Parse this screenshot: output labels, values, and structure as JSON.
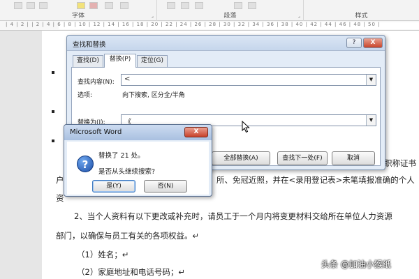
{
  "ribbon": {
    "groups": [
      "字体",
      "段落",
      "样式"
    ]
  },
  "ruler": {
    "text": "| 4 | 2 | | 2 | 4 | 6 | 8 | 10 | 12 | 14 | 16 | 18 | 20 | 22 | 24 | 26 | 28 | 30 | 32 | 34 | 36 | 38 | 40 | 42 | 44 | 46 | 48 | 50 |"
  },
  "document": {
    "line_r1": "职称证书",
    "line_a_prefix": "户",
    "line_a_suffix": "所、免冠近照，并在<录用登记表>未笔填报准确的个人",
    "line_b": "资",
    "para2_line1": "2、当个人资料有以下更改或补充时，请员工于一个月内将变更材料交给所在单位人力资源",
    "para2_line2": "部门，以确保与员工有关的各项权益。↵",
    "item1": "（1）姓名；↵",
    "item2": "（2）家庭地址和电话号码；↵"
  },
  "find_replace": {
    "title": "查找和替换",
    "help": "?",
    "close": "X",
    "tabs": [
      "查找(D)",
      "替换(P)",
      "定位(G)"
    ],
    "find_label": "查找内容(N):",
    "find_value": "<",
    "options_label": "选项:",
    "options_value": "向下搜索, 区分全/半角",
    "replace_label": "替换为(I):",
    "replace_value": "《",
    "buttons": {
      "replace_all": "全部替换(A)",
      "find_next": "查找下一处(F)",
      "cancel": "取消"
    }
  },
  "message_box": {
    "title": "Microsoft Word",
    "close": "X",
    "line1": "替换了 21 处。",
    "line2": "是否从头继续搜索?",
    "yes": "是(Y)",
    "no": "否(N)"
  },
  "watermark": "头条 @加油小猴纸"
}
